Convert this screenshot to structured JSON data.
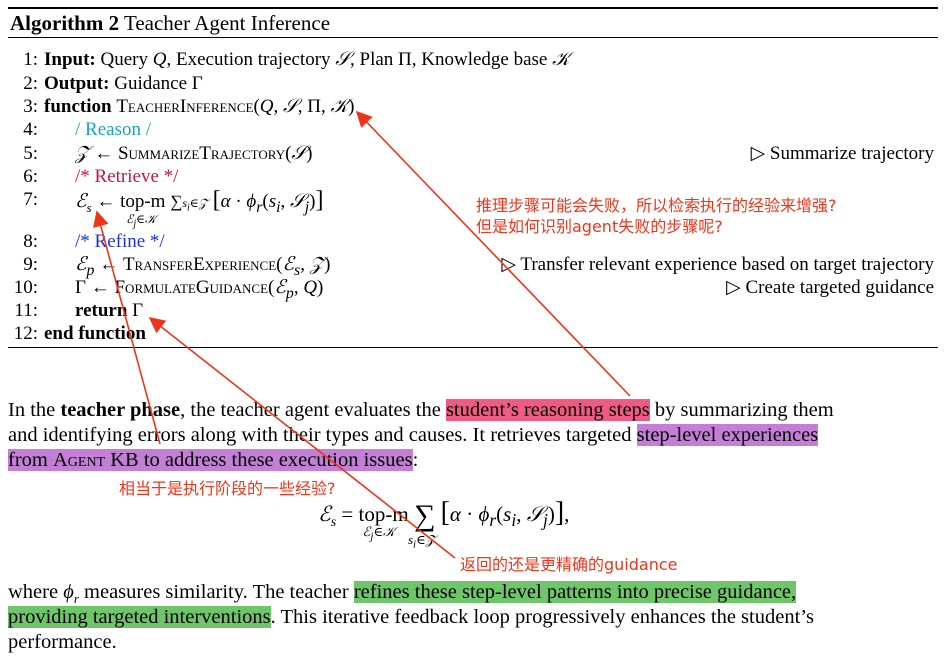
{
  "algorithm": {
    "label": "Algorithm 2",
    "title": "Teacher Agent Inference",
    "lines": [
      {
        "num": "1:",
        "text": "Input: Query Q, Execution trajectory S, Plan Π, Knowledge base K"
      },
      {
        "num": "2:",
        "text": "Output: Guidance Γ"
      },
      {
        "num": "3:",
        "text": "function TeacherInference(Q, S, Π, K)"
      },
      {
        "num": "4:",
        "text": "/ Reason /"
      },
      {
        "num": "5:",
        "text": "Z ← SummarizeTrajectory(S)",
        "comment": "▷ Summarize trajectory"
      },
      {
        "num": "6:",
        "text": "/* Retrieve */"
      },
      {
        "num": "7:",
        "text": "Es ← top-m over Ej∈K of Σ si∈Z [α · φr(si, Sj)]"
      },
      {
        "num": "8:",
        "text": "/* Refine */"
      },
      {
        "num": "9:",
        "text": "Ep ← TransferExperience(Es, Z)",
        "comment": "▷ Transfer relevant experience based on target trajectory"
      },
      {
        "num": "10:",
        "text": "Γ ← FormulateGuidance(Ep, Q)",
        "comment": "▷ Create targeted guidance"
      },
      {
        "num": "11:",
        "text": "return Γ"
      },
      {
        "num": "12:",
        "text": "end function"
      }
    ]
  },
  "paragraph1": {
    "p1": "In the ",
    "p2": "teacher phase",
    "p3": ", the teacher agent evaluates the ",
    "hl1": "student’s reasoning steps",
    "p4": " by summarizing them",
    "line2_text": "and identifying errors along with their types and causes. It retrieves targeted ",
    "hl2a": "step-level experiences",
    "hl2b_1": "from ",
    "hl2b_sc": "Agent KB",
    "hl2b_2": " to address these execution issues",
    "tail": ":"
  },
  "equation": {
    "text": "Es = top-m over Ej∈K of Σ si∈Z [α · φr(si, Sj)],"
  },
  "paragraph2": {
    "p1": "where ",
    "phi": "φr",
    "p2": " measures similarity. The teacher ",
    "hl3a": "refines these step-level patterns into precise guidance,",
    "hl3b": "providing targeted interventions",
    "p3": ". This iterative feedback loop progressively enhances the student’s",
    "p4": "performance."
  },
  "annotations": {
    "note1_line1": "推理步骤可能会失败，所以检索执行的经验来增强?",
    "note1_line2": "但是如何识别agent失败的步骤呢?",
    "note2": "相当于是执行阶段的一些经验?",
    "note3": "返回的还是更精确的guidance",
    "color": "#f0341a"
  }
}
